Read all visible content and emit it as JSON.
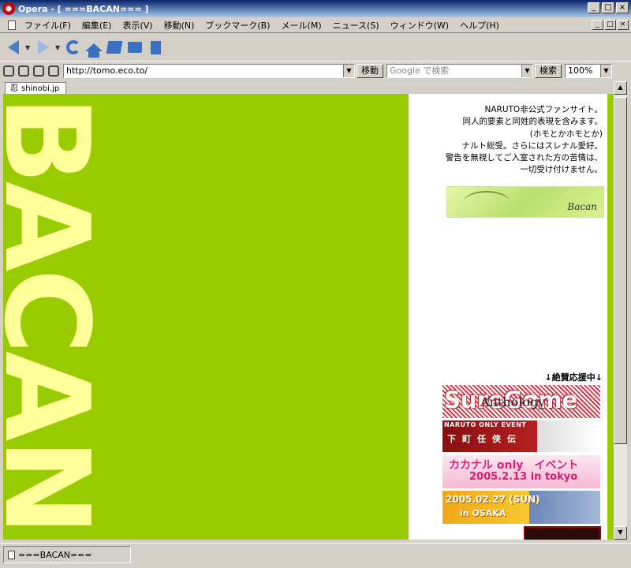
{
  "window": {
    "title": "Opera - [ ===BACAN=== ]",
    "buttons": {
      "min": "_",
      "max": "□",
      "close": "×"
    }
  },
  "menu": {
    "items": [
      "ファイル(F)",
      "編集(E)",
      "表示(V)",
      "移動(N)",
      "ブックマーク(B)",
      "メール(M)",
      "ニュース(S)",
      "ウィンドウ(W)",
      "ヘルプ(H)"
    ]
  },
  "address_bar": {
    "url": "http://tomo.eco.to/",
    "go_label": "移動",
    "search_placeholder": "Google で検索",
    "search_label": "検索",
    "zoom": "100%"
  },
  "tab": {
    "label": "shinobi.jp",
    "icon": "忍"
  },
  "page": {
    "vertical_title": "BACAN",
    "intro_lines": [
      "NARUTO非公式ファンサイト。",
      "同人的要素と同姓的表現を含みます。",
      "(ホモとかホモとか)",
      "ナルト総受。さらにはスレナル愛好。",
      "警告を無視してご入室された方の苦情は、",
      "一切受け付けません。"
    ],
    "banner_top_sig": "Bacan",
    "support_heading": "↓絶賛応援中↓",
    "banners": {
      "b1_main": "SureGome",
      "b1_sub": "Anthology",
      "b2_top": "NARUTO ONLY EVENT",
      "b2_main": "下町任侠伝",
      "b3_line1": "カカナル only　イベント",
      "b3_line2": "2005.2.13 in tokyo",
      "b4_line1": "2005.02.27 (SUN)",
      "b4_line2": "in OSAKA"
    },
    "colors": {
      "background": "#99cc00",
      "title": "#ffff99"
    }
  },
  "status": {
    "text": "===BACAN==="
  }
}
